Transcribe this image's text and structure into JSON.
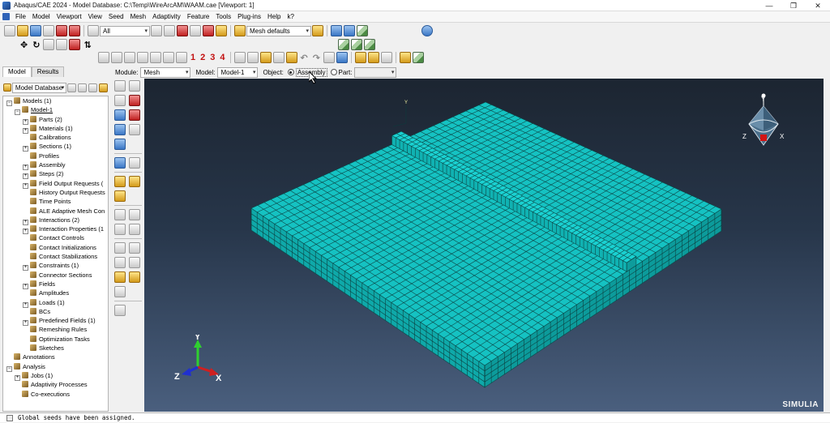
{
  "window": {
    "title": "Abaqus/CAE 2024 - Model Database: C:\\Temp\\WireArcAM\\WAAM.cae [Viewport: 1]",
    "buttons": [
      "—",
      "❐",
      "✕"
    ]
  },
  "menu": {
    "items": [
      "File",
      "Model",
      "Viewport",
      "View",
      "Seed",
      "Mesh",
      "Adaptivity",
      "Feature",
      "Tools",
      "Plug-ins",
      "Help",
      "k?"
    ]
  },
  "toolbar": {
    "selection_filter": "All",
    "mesh_defaults": "Mesh defaults",
    "viewport_numbers": [
      "1",
      "2",
      "3",
      "4"
    ]
  },
  "context": {
    "module_label": "Module:",
    "module_value": "Mesh",
    "model_label": "Model:",
    "model_value": "Model-1",
    "object_label": "Object:",
    "assembly_label": "Assembly",
    "part_label": "Part:",
    "part_value": ""
  },
  "panel": {
    "tabs": [
      "Model",
      "Results"
    ],
    "database_combo": "Model Database",
    "tree": [
      {
        "label": "Models (1)",
        "level": 0,
        "exp": "−"
      },
      {
        "label": "Model-1",
        "level": 1,
        "exp": "−",
        "underline": true
      },
      {
        "label": "Parts (2)",
        "level": 2,
        "exp": "+"
      },
      {
        "label": "Materials (1)",
        "level": 2,
        "exp": "+"
      },
      {
        "label": "Calibrations",
        "level": 2,
        "exp": ""
      },
      {
        "label": "Sections (1)",
        "level": 2,
        "exp": "+"
      },
      {
        "label": "Profiles",
        "level": 2,
        "exp": ""
      },
      {
        "label": "Assembly",
        "level": 2,
        "exp": "+"
      },
      {
        "label": "Steps (2)",
        "level": 2,
        "exp": "+"
      },
      {
        "label": "Field Output Requests (",
        "level": 2,
        "exp": "+"
      },
      {
        "label": "History Output Requests",
        "level": 2,
        "exp": ""
      },
      {
        "label": "Time Points",
        "level": 2,
        "exp": ""
      },
      {
        "label": "ALE Adaptive Mesh Con",
        "level": 2,
        "exp": ""
      },
      {
        "label": "Interactions (2)",
        "level": 2,
        "exp": "+"
      },
      {
        "label": "Interaction Properties (1",
        "level": 2,
        "exp": "+"
      },
      {
        "label": "Contact Controls",
        "level": 2,
        "exp": ""
      },
      {
        "label": "Contact Initializations",
        "level": 2,
        "exp": ""
      },
      {
        "label": "Contact Stabilizations",
        "level": 2,
        "exp": ""
      },
      {
        "label": "Constraints (1)",
        "level": 2,
        "exp": "+"
      },
      {
        "label": "Connector Sections",
        "level": 2,
        "exp": ""
      },
      {
        "label": "Fields",
        "level": 2,
        "exp": "+"
      },
      {
        "label": "Amplitudes",
        "level": 2,
        "exp": ""
      },
      {
        "label": "Loads (1)",
        "level": 2,
        "exp": "+"
      },
      {
        "label": "BCs",
        "level": 2,
        "exp": ""
      },
      {
        "label": "Predefined Fields (1)",
        "level": 2,
        "exp": "+"
      },
      {
        "label": "Remeshing Rules",
        "level": 2,
        "exp": ""
      },
      {
        "label": "Optimization Tasks",
        "level": 2,
        "exp": ""
      },
      {
        "label": "Sketches",
        "level": 2,
        "exp": ""
      },
      {
        "label": "Annotations",
        "level": 0,
        "exp": ""
      },
      {
        "label": "Analysis",
        "level": 0,
        "exp": "−"
      },
      {
        "label": "Jobs (1)",
        "level": 1,
        "exp": "+"
      },
      {
        "label": "Adaptivity Processes",
        "level": 1,
        "exp": ""
      },
      {
        "label": "Co-executions",
        "level": 1,
        "exp": ""
      }
    ]
  },
  "viewport": {
    "brand": "SIMULIA",
    "triad_labels": {
      "y": "Y",
      "z": "Z",
      "x": "X"
    },
    "mesh_color": "#15c2c2"
  },
  "messages": {
    "line1": "Global seeds have been assigned."
  }
}
